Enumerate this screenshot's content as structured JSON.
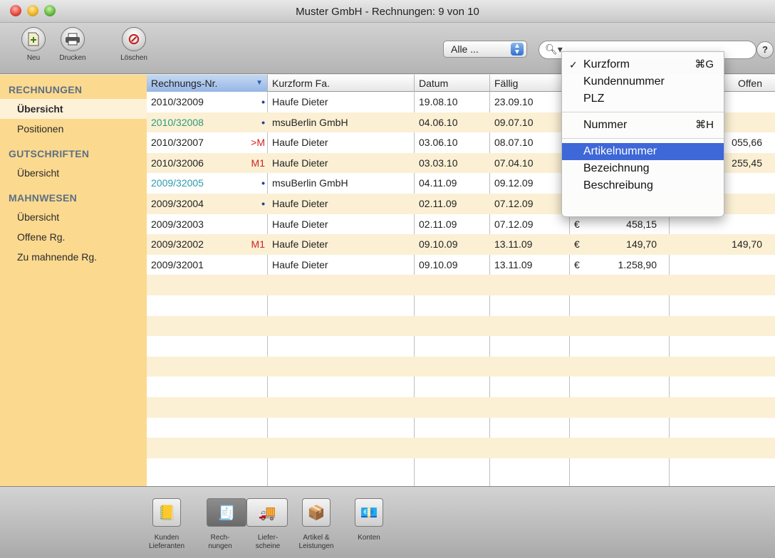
{
  "window": {
    "title": "Muster GmbH - Rechnungen: 9 von 10"
  },
  "toolbar": {
    "new_label": "Neu",
    "print_label": "Drucken",
    "delete_label": "Löschen",
    "filter_value": "Alle ..."
  },
  "sidebar": {
    "sections": [
      {
        "title": "RECHNUNGEN",
        "items": [
          "Übersicht",
          "Positionen"
        ]
      },
      {
        "title": "GUTSCHRIFTEN",
        "items": [
          "Übersicht"
        ]
      },
      {
        "title": "MAHNWESEN",
        "items": [
          "Übersicht",
          "Offene Rg.",
          "Zu mahnende Rg."
        ]
      }
    ]
  },
  "table": {
    "headers": [
      "Rechnungs-Nr.",
      "Kurzform Fa.",
      "Datum",
      "Fällig",
      "",
      "Offen"
    ],
    "rows": [
      {
        "nr": "2010/32009",
        "mark": "•",
        "firm": "Haufe Dieter",
        "datum": "19.08.10",
        "faellig": "23.09.10",
        "cur": "",
        "betrag": "",
        "offen": ""
      },
      {
        "nr": "2010/32008",
        "mark": "•",
        "firm": "msuBerlin GmbH",
        "datum": "04.06.10",
        "faellig": "09.07.10",
        "cur": "",
        "betrag": "",
        "offen": ""
      },
      {
        "nr": "2010/32007",
        "mark": ">M",
        "firm": "Haufe Dieter",
        "datum": "03.06.10",
        "faellig": "08.07.10",
        "cur": "",
        "betrag": "",
        "offen": "055,66"
      },
      {
        "nr": "2010/32006",
        "mark": "M1",
        "firm": "Haufe Dieter",
        "datum": "03.03.10",
        "faellig": "07.04.10",
        "cur": "",
        "betrag": "",
        "offen": "255,45"
      },
      {
        "nr": "2009/32005",
        "mark": "•",
        "firm": "msuBerlin GmbH",
        "datum": "04.11.09",
        "faellig": "09.12.09",
        "cur": "",
        "betrag": "",
        "offen": ""
      },
      {
        "nr": "2009/32004",
        "mark": "•",
        "firm": "Haufe Dieter",
        "datum": "02.11.09",
        "faellig": "07.12.09",
        "cur": "",
        "betrag": "",
        "offen": ""
      },
      {
        "nr": "2009/32003",
        "mark": "",
        "firm": "Haufe Dieter",
        "datum": "02.11.09",
        "faellig": "07.12.09",
        "cur": "€",
        "betrag": "458,15",
        "offen": ""
      },
      {
        "nr": "2009/32002",
        "mark": "M1",
        "firm": "Haufe Dieter",
        "datum": "09.10.09",
        "faellig": "13.11.09",
        "cur": "€",
        "betrag": "149,70",
        "offen": "149,70"
      },
      {
        "nr": "2009/32001",
        "mark": "",
        "firm": "Haufe Dieter",
        "datum": "09.10.09",
        "faellig": "13.11.09",
        "cur": "€",
        "betrag": "1.258,90",
        "offen": ""
      }
    ]
  },
  "search_menu": {
    "items": [
      {
        "label": "Kurzform",
        "shortcut": "⌘G",
        "checked": true
      },
      {
        "label": "Kundennummer",
        "shortcut": ""
      },
      {
        "label": "PLZ",
        "shortcut": ""
      },
      {
        "sep": true
      },
      {
        "label": "Nummer",
        "shortcut": "⌘H"
      },
      {
        "sep": true
      },
      {
        "label": "Artikelnummer",
        "shortcut": "",
        "highlighted": true
      },
      {
        "label": "Bezeichnung",
        "shortcut": ""
      },
      {
        "label": "Beschreibung",
        "shortcut": ""
      }
    ]
  },
  "dock": {
    "items": [
      {
        "label": "Kunden\nLieferanten",
        "icon": "address-book-icon"
      },
      {
        "label": "Rech-\nnungen",
        "icon": "invoice-icon",
        "active": true
      },
      {
        "label": "Liefer-\nscheine",
        "icon": "truck-icon"
      },
      {
        "label": "Artikel &\nLeistungen",
        "icon": "box-icon"
      },
      {
        "label": "Konten",
        "icon": "money-icon"
      }
    ]
  },
  "colors": {
    "sidebar": "#fbd98f",
    "row_alt": "#fbf0d4",
    "menu_highlight": "#3e67d8",
    "mark_red": "#d32222",
    "invoice_green": "#2d9a77",
    "invoice_teal": "#2a9bb0"
  }
}
